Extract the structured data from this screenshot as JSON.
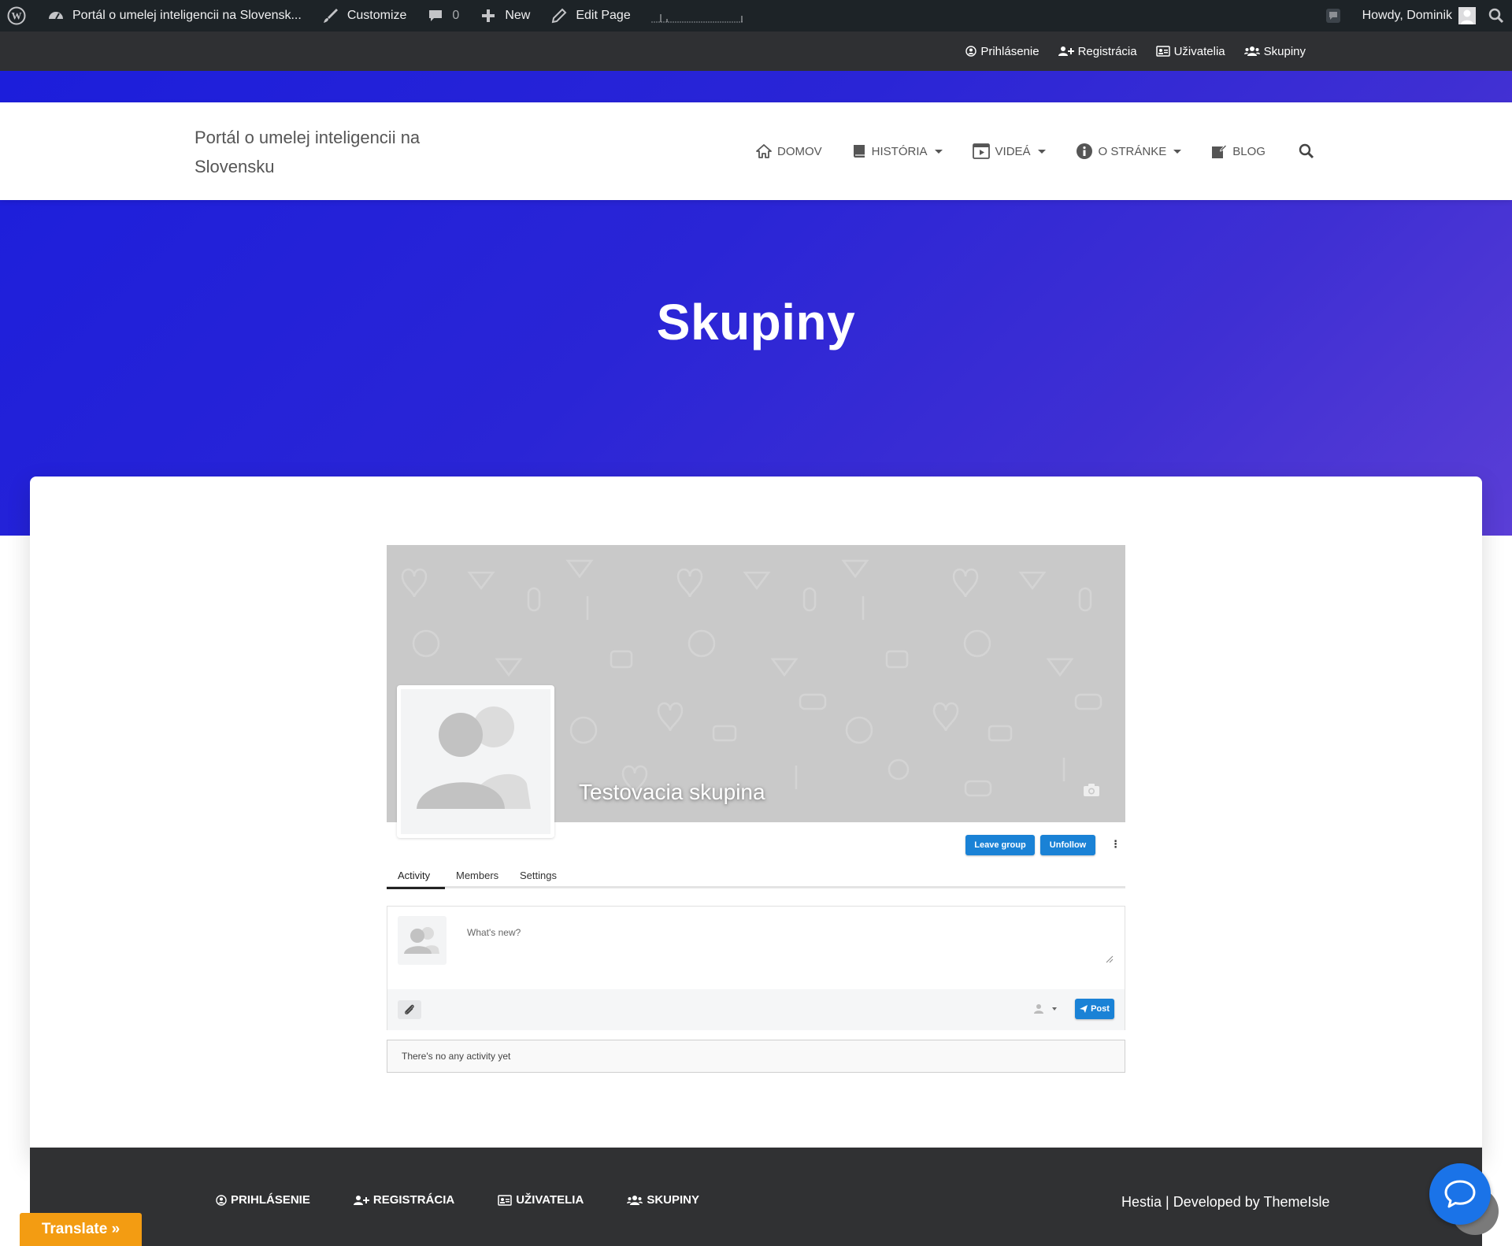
{
  "admin_bar": {
    "site_name": "Portál o umelej inteligencii na Slovensk...",
    "customize": "Customize",
    "comments_count": "0",
    "new": "New",
    "edit_page": "Edit Page",
    "greeting": "Howdy, Dominik"
  },
  "top_bar": {
    "links": [
      "Prihlásenie",
      "Registrácia",
      "Uživatelia",
      "Skupiny"
    ]
  },
  "header": {
    "brand": "Portál o umelej inteligencii na Slovensku",
    "menu": [
      "DOMOV",
      "HISTÓRIA",
      "VIDEÁ",
      "O STRÁNKE",
      "BLOG"
    ]
  },
  "page": {
    "title": "Skupiny"
  },
  "group": {
    "name": "Testovacia skupina",
    "leave_label": "Leave group",
    "unfollow_label": "Unfollow",
    "more_label": "⋮",
    "tabs": [
      "Activity",
      "Members",
      "Settings"
    ],
    "active_tab": "Activity",
    "post_placeholder": "What's new?",
    "post_label": "Post",
    "empty_message": "There's no any activity yet"
  },
  "footer": {
    "links": [
      "PRIHLÁSENIE",
      "REGISTRÁCIA",
      "UŽIVATELIA",
      "SKUPINY"
    ],
    "credit_prefix": "Hestia | Developed by ",
    "credit_link": "ThemeIsle"
  },
  "translate_label": "Translate »",
  "colors": {
    "accent": "#1a82d6",
    "hero_start": "#1c1edb",
    "hero_end": "#5a3ed6",
    "admin_bar": "#1d2327",
    "footer": "#303133",
    "translate": "#f39c12"
  },
  "icons": [
    "wordpress-icon",
    "dashboard-icon",
    "brush-icon",
    "comment-icon",
    "plus-icon",
    "pencil-icon",
    "user-circle-icon",
    "user-plus-icon",
    "id-card-icon",
    "users-icon",
    "home-icon",
    "book-icon",
    "film-icon",
    "info-icon",
    "edit-icon",
    "search-icon",
    "camera-icon",
    "paperclip-icon",
    "paper-plane-icon",
    "chat-icon"
  ]
}
